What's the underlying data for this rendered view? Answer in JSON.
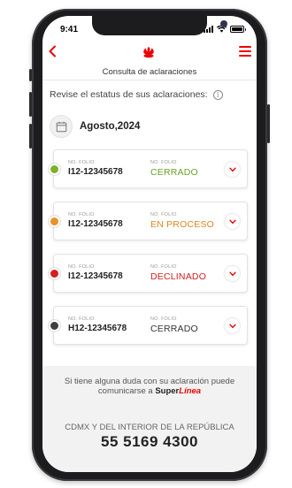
{
  "status_bar": {
    "time": "9:41"
  },
  "header": {
    "subtitle": "Consulta de aclaraciones"
  },
  "intro": {
    "text": "Revise el estatus de sus aclaraciones:"
  },
  "date_filter": {
    "label": "Agosto,2024"
  },
  "colors": {
    "brand": "#ec0000",
    "cerrado_green": "#7db02a",
    "proceso_orange": "#e8932a",
    "declinado_red": "#d51e1e",
    "neutral_dark": "#4a4a4a"
  },
  "aclaraciones": [
    {
      "folio_label": "NO. FOLIO",
      "folio": "I12-12345678",
      "estado_label": "NO. FOLIO",
      "estado": "CERRADO",
      "dot_color": "#7db02a",
      "estado_color": "#6aa225"
    },
    {
      "folio_label": "NO. FOLIO",
      "folio": "I12-12345678",
      "estado_label": "NO. FOLIO",
      "estado": "EN PROCESO",
      "dot_color": "#e8932a",
      "estado_color": "#e0861c"
    },
    {
      "folio_label": "NO. FOLIO",
      "folio": "I12-12345678",
      "estado_label": "NO. FOLIO",
      "estado": "DECLINADO",
      "dot_color": "#d51e1e",
      "estado_color": "#cf1f1f"
    },
    {
      "folio_label": "NO. FOLIO",
      "folio": "H12-12345678",
      "estado_label": "NO. FOLIO",
      "estado": "CERRADO",
      "dot_color": "#3f3f3f",
      "estado_color": "#333333"
    }
  ],
  "footer": {
    "help_line1": "Si tiene alguna duda con su aclaración puede",
    "help_line2": "comunicarse a",
    "brand_super": "Super",
    "brand_linea": "Línea",
    "region": "CDMX Y DEL INTERIOR DE LA REPÚBLICA",
    "phone": "55 5169 4300"
  }
}
